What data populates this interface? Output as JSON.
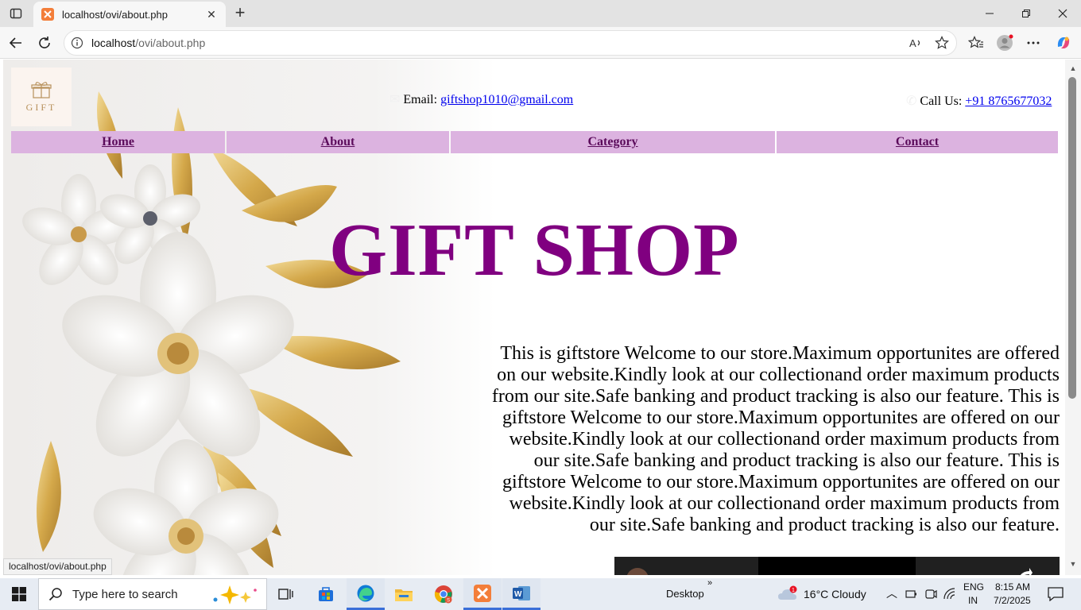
{
  "browser": {
    "tab_title": "localhost/ovi/about.php",
    "url_host": "localhost",
    "url_path": "/ovi/about.php"
  },
  "page": {
    "email_label": "Email:",
    "email": "giftshop1010@gmail.com",
    "call_label": "Call Us:",
    "phone": "+91 8765677032",
    "logo_text": "GIFT",
    "menu": [
      {
        "label": "Home"
      },
      {
        "label": "About"
      },
      {
        "label": "Category"
      },
      {
        "label": "Contact"
      }
    ],
    "hero_title": "GIFT SHOP",
    "about_paragraph": "This is giftstore Welcome to our store.Maximum opportunites are offered on our website.Kindly look at our collectionand order maximum products from our site.Safe banking and product tracking is also our feature.",
    "status_url": "localhost/ovi/about.php"
  },
  "taskbar": {
    "search_placeholder": "Type here to search",
    "desktop_label": "Desktop",
    "weather": "16°C  Cloudy",
    "lang_top": "ENG",
    "lang_bottom": "IN",
    "time": "8:15 AM",
    "date": "7/2/2025"
  },
  "colors": {
    "menu_bg": "#dcb3e0",
    "hero": "#800080",
    "link": "#0000ee"
  }
}
